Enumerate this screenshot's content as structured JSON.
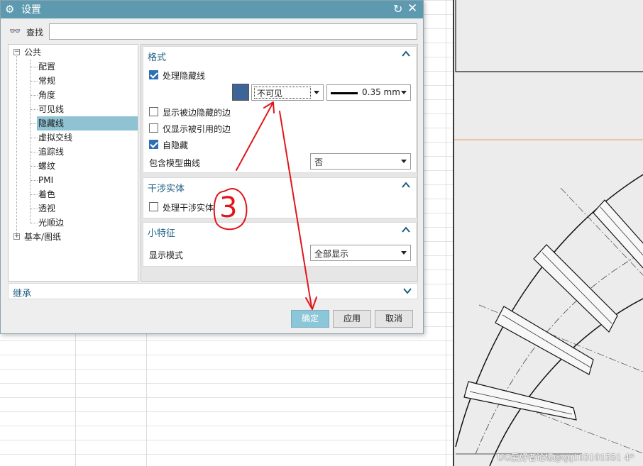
{
  "dialog": {
    "title": "设置",
    "title_icon": "gear-icon",
    "reset_icon": "reset-icon",
    "close_icon": "close-icon"
  },
  "search": {
    "label": "查找",
    "icon": "binoculars-icon",
    "value": "",
    "placeholder": ""
  },
  "tree": {
    "groups": [
      {
        "label": "公共",
        "expanded": true,
        "items": [
          {
            "label": "配置"
          },
          {
            "label": "常规"
          },
          {
            "label": "角度"
          },
          {
            "label": "可见线"
          },
          {
            "label": "隐藏线",
            "selected": true
          },
          {
            "label": "虚拟交线"
          },
          {
            "label": "追踪线"
          },
          {
            "label": "螺纹"
          },
          {
            "label": "PMI"
          },
          {
            "label": "着色"
          },
          {
            "label": "透视"
          },
          {
            "label": "光顺边"
          }
        ]
      },
      {
        "label": "基本/图纸",
        "expanded": false
      }
    ],
    "expand_symbol": "+",
    "collapse_symbol": "−"
  },
  "format": {
    "title": "格式",
    "process_hidden": {
      "label": "处理隐藏线",
      "checked": true
    },
    "color_swatch": "#3c6496",
    "line_style": "不可见",
    "line_width": "0.35 mm",
    "show_hidden_by_edges": {
      "label": "显示被边隐藏的边",
      "checked": false
    },
    "show_only_referenced": {
      "label": "仅显示被引用的边",
      "checked": false
    },
    "self_hidden": {
      "label": "自隐藏",
      "checked": true
    },
    "include_model_curves": {
      "label": "包含模型曲线",
      "value": "否"
    }
  },
  "interference": {
    "title": "干涉实体",
    "process": {
      "label": "处理干涉实体",
      "checked": false
    }
  },
  "small_features": {
    "title": "小特征",
    "display_mode_label": "显示模式",
    "display_mode_value": "全部显示"
  },
  "inherit": {
    "title": "继承"
  },
  "buttons": {
    "ok": "确定",
    "apply": "应用",
    "cancel": "取消"
  },
  "annotation": {
    "text": "3",
    "color": "#e0161b"
  },
  "watermark": "UG爱好者论坛@qq103101551 4*"
}
